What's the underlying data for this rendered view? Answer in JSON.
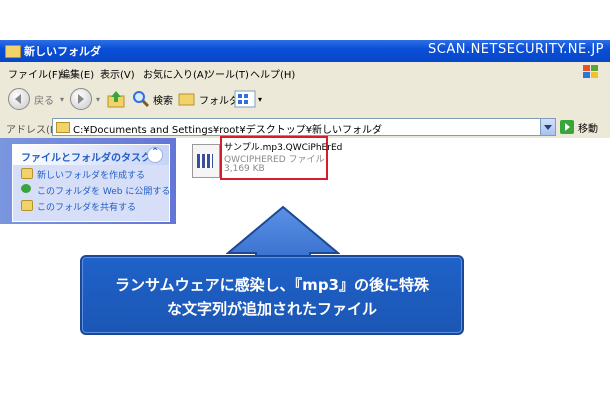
{
  "window": {
    "title": "新しいフォルダ",
    "watermark": "SCAN.NETSECURITY.NE.JP"
  },
  "menubar": {
    "items": [
      "ファイル(F)",
      "編集(E)",
      "表示(V)",
      "お気に入り(A)",
      "ツール(T)",
      "ヘルプ(H)"
    ]
  },
  "toolbar": {
    "back_label": "戻る",
    "search_label": "検索",
    "folder_label": "フォルダ"
  },
  "address": {
    "label": "アドレス(D)",
    "path": "C:¥Documents and Settings¥root¥デスクトップ¥新しいフォルダ",
    "go_label": "移動"
  },
  "tasks": {
    "header": "ファイルとフォルダのタスク",
    "items": [
      "新しいフォルダを作成する",
      "このフォルダを Web に公開する",
      "このフォルダを共有する"
    ]
  },
  "file": {
    "name": "サンプル.mp3.QWCiPhErEd",
    "type": "QWCIPHERED ファイル",
    "size": "3,169 KB"
  },
  "callout": {
    "line1": "ランサムウェアに感染し、『mp3』の後に特殊",
    "line2": "な文字列が追加されたファイル"
  },
  "colors": {
    "titlebar": "#0a4fd8",
    "highlight": "#d51d2b",
    "callout": "#1f62c9"
  }
}
